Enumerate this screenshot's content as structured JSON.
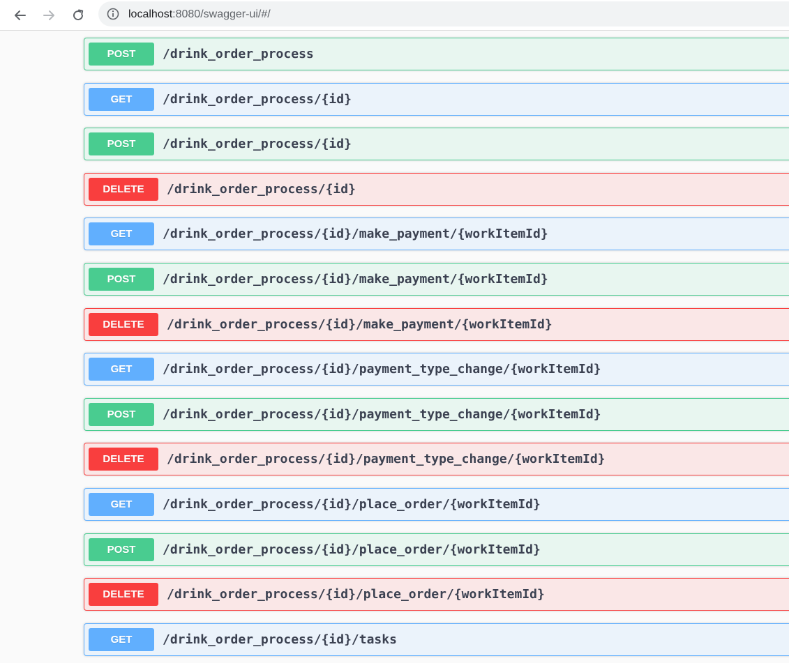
{
  "browser": {
    "url_host": "localhost",
    "url_rest": ":8080/swagger-ui/#/",
    "back_icon": "arrow-left-icon",
    "forward_icon": "arrow-right-icon",
    "reload_icon": "reload-icon",
    "info_icon": "info-icon"
  },
  "colors": {
    "post": "#49cc90",
    "get": "#61affe",
    "delete": "#f93e3e",
    "path_text": "#3b4151"
  },
  "operations": [
    {
      "method": "POST",
      "path": "/drink_order_process"
    },
    {
      "method": "GET",
      "path": "/drink_order_process/{id}"
    },
    {
      "method": "POST",
      "path": "/drink_order_process/{id}"
    },
    {
      "method": "DELETE",
      "path": "/drink_order_process/{id}"
    },
    {
      "method": "GET",
      "path": "/drink_order_process/{id}/make_payment/{workItemId}"
    },
    {
      "method": "POST",
      "path": "/drink_order_process/{id}/make_payment/{workItemId}"
    },
    {
      "method": "DELETE",
      "path": "/drink_order_process/{id}/make_payment/{workItemId}"
    },
    {
      "method": "GET",
      "path": "/drink_order_process/{id}/payment_type_change/{workItemId}"
    },
    {
      "method": "POST",
      "path": "/drink_order_process/{id}/payment_type_change/{workItemId}"
    },
    {
      "method": "DELETE",
      "path": "/drink_order_process/{id}/payment_type_change/{workItemId}"
    },
    {
      "method": "GET",
      "path": "/drink_order_process/{id}/place_order/{workItemId}"
    },
    {
      "method": "POST",
      "path": "/drink_order_process/{id}/place_order/{workItemId}"
    },
    {
      "method": "DELETE",
      "path": "/drink_order_process/{id}/place_order/{workItemId}"
    },
    {
      "method": "GET",
      "path": "/drink_order_process/{id}/tasks"
    }
  ]
}
